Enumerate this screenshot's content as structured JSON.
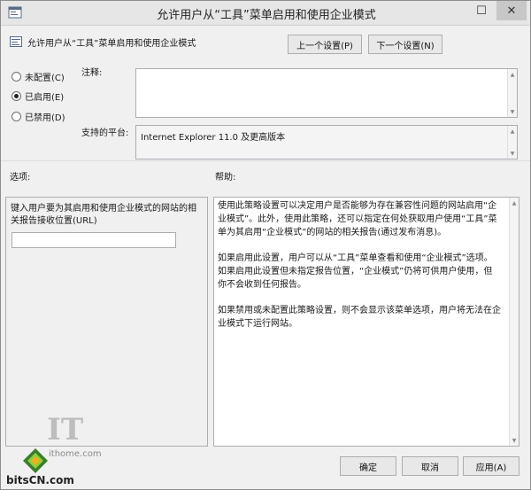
{
  "window": {
    "title": "允许用户从“工具”菜单启用和使用企业模式",
    "maximize_glyph": "☐",
    "close_glyph": "✕"
  },
  "header": {
    "policy_title": "允许用户从“工具”菜单启用和使用企业模式",
    "prev_label": "上一个设置(P)",
    "next_label": "下一个设置(N)"
  },
  "state": {
    "options": [
      {
        "label": "未配置(C)",
        "checked": false
      },
      {
        "label": "已启用(E)",
        "checked": true
      },
      {
        "label": "已禁用(D)",
        "checked": false
      }
    ]
  },
  "comment": {
    "label": "注释:",
    "value": ""
  },
  "platform": {
    "label": "支持的平台:",
    "value": "Internet Explorer 11.0 及更高版本"
  },
  "options_section": {
    "label": "选项:",
    "field_label": "键入用户要为其启用和使用企业模式的网站的相关报告接收位置(URL)",
    "url_value": ""
  },
  "help_section": {
    "label": "帮助:",
    "paragraphs": [
      "使用此策略设置可以决定用户是否能够为存在兼容性问题的网站启用“企业模式”。此外，使用此策略，还可以指定在何处获取用户使用“工具”菜单为其启用“企业模式”的网站的相关报告(通过发布消息)。",
      "如果启用此设置，用户可以从“工具”菜单查看和使用“企业模式”选项。如果启用此设置但未指定报告位置，“企业模式”仍将可供用户使用，但你不会收到任何报告。",
      "如果禁用或未配置此策略设置，则不会显示该菜单选项，用户将无法在企业模式下运行网站。"
    ]
  },
  "footer": {
    "ok_label": "确定",
    "cancel_label": "取消",
    "apply_label": "应用(A)"
  },
  "watermark": {
    "logo_text": "IT",
    "site_text": "ithome.com",
    "bits_text": "bitsCN.com"
  }
}
